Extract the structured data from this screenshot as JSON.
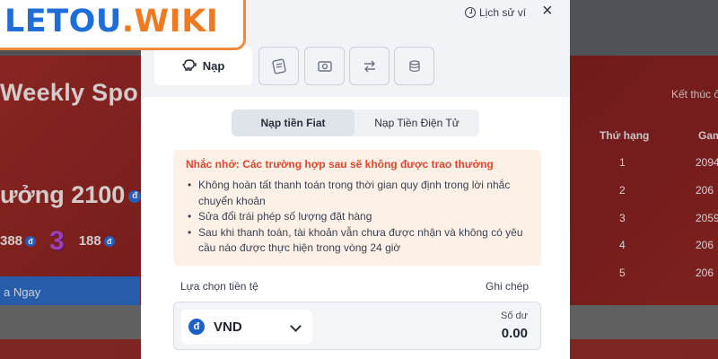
{
  "logo": {
    "part1": "LETOU",
    "part2": ".WIKI"
  },
  "background": {
    "title": "Weekly Spo",
    "prize_text": "ưởng 2100",
    "prize_coin": "đ",
    "sub_prize_1": "388",
    "sub_prize_rank": "3",
    "sub_prize_2": "188",
    "coin": "đ",
    "button_label": "a Ngay",
    "ends_label": "Kết thúc ở",
    "rank_header": "Thứ hạng",
    "game_header": "Gam",
    "ranks": [
      {
        "rank": "1",
        "value": "2094"
      },
      {
        "rank": "2",
        "value": "206"
      },
      {
        "rank": "3",
        "value": "2059"
      },
      {
        "rank": "4",
        "value": "206"
      },
      {
        "rank": "5",
        "value": "206"
      }
    ]
  },
  "modal": {
    "history_label": "Lịch sử ví",
    "close_icon": "×",
    "tabs": {
      "deposit_label": "Nạp",
      "deposit_icon": "piggy-bank-icon",
      "icon_tabs": [
        "voucher-icon",
        "cash-icon",
        "transfer-icon",
        "coins-icon"
      ]
    },
    "segments": {
      "fiat": "Nạp tiền Fiat",
      "crypto": "Nạp Tiền Điện Tử",
      "active": "fiat"
    },
    "notice": {
      "title": "Nhắc nhở: Các trường hợp sau sẽ không được trao thưởng",
      "items": [
        "Không hoàn tất thanh toán trong thời gian quy định trong lời nhắc chuyển khoản",
        "Sửa đổi trái phép số lượng đặt hàng",
        "Sau khi thanh toán, tài khoản vẫn chưa được nhận và không có yêu cầu nào được thực hiện trong vòng 24 giờ"
      ]
    },
    "currency": {
      "label": "Lựa chọn tiền tệ",
      "note_label": "Ghi chép",
      "selected": "VND",
      "symbol": "đ",
      "balance_label": "Số dư",
      "balance": "0.00"
    }
  },
  "colors": {
    "accent_orange": "#f07a22",
    "brand_blue": "#1e6dd8",
    "warning_red": "#e2462c",
    "notice_bg": "#fdf1e7"
  }
}
